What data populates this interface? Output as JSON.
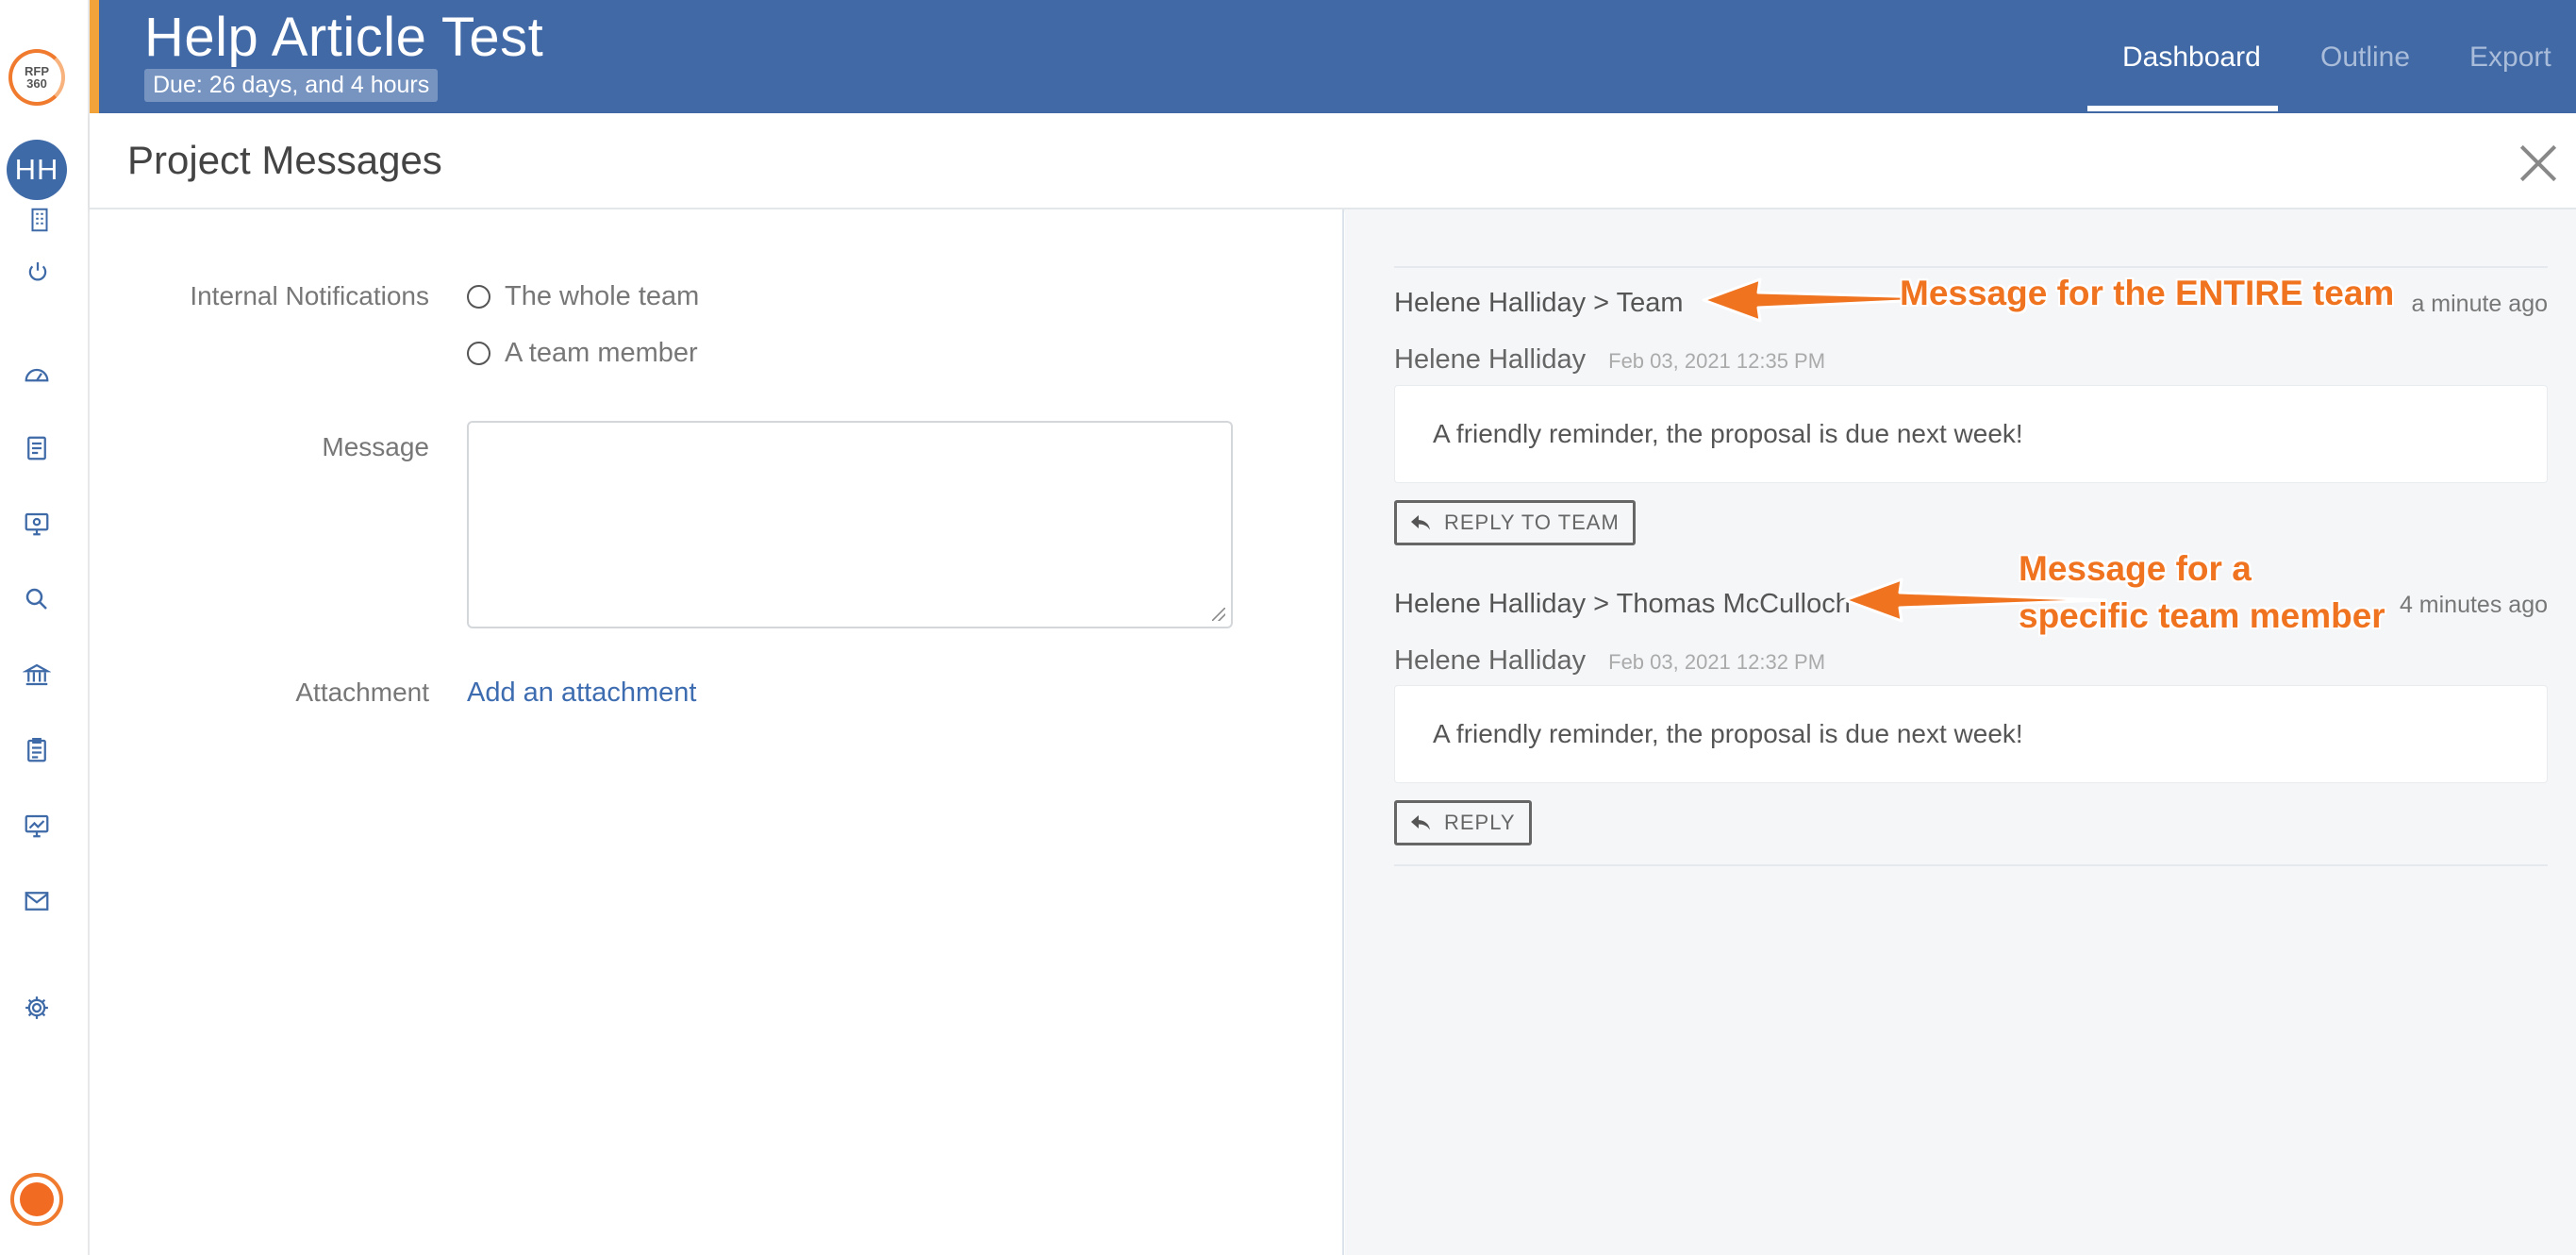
{
  "sidebar": {
    "logo_text": [
      "RFP",
      "360"
    ],
    "avatar_initials": "HH",
    "icons": [
      "building-icon",
      "power-icon",
      "dashboard-icon",
      "document-icon",
      "monitor-icon",
      "search-icon",
      "bank-icon",
      "clipboard-icon",
      "analytics-icon",
      "mail-icon",
      "gear-icon"
    ]
  },
  "header": {
    "project_title": "Help Article Test",
    "due": "Due: 26 days, and 4 hours",
    "tabs": [
      {
        "label": "Dashboard",
        "active": true
      },
      {
        "label": "Outline",
        "active": false
      },
      {
        "label": "Export",
        "active": false
      }
    ]
  },
  "modal": {
    "title": "Project Messages"
  },
  "form": {
    "internal_notifications_label": "Internal Notifications",
    "option_whole_team": "The whole team",
    "option_team_member": "A team member",
    "message_label": "Message",
    "message_value": "",
    "attachment_label": "Attachment",
    "add_attachment": "Add an attachment"
  },
  "messages": [
    {
      "header": "Helene Halliday > Team",
      "time_ago": "a minute ago",
      "author": "Helene Halliday",
      "date": "Feb 03, 2021 12:35 PM",
      "body": "A friendly reminder, the proposal is due next week!",
      "reply_label": "REPLY TO TEAM"
    },
    {
      "header": "Helene Halliday > Thomas McCulloch",
      "time_ago": "4 minutes ago",
      "author": "Helene Halliday",
      "date": "Feb 03, 2021 12:32 PM",
      "body": "A friendly reminder, the proposal is due next week!",
      "reply_label": "REPLY"
    }
  ],
  "annotations": {
    "entire_team": "Message for the ENTIRE team",
    "specific_member_line1": "Message for a",
    "specific_member_line2": "specific team member",
    "color": "#f07320"
  },
  "colors": {
    "header_bg": "#4169a6",
    "accent_orange": "#f2a43a",
    "link": "#3d6cb0",
    "panel_bg": "#f4f6f8"
  }
}
